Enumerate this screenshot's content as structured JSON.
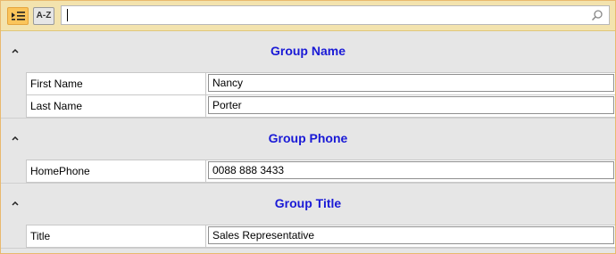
{
  "toolbar": {
    "categorized_icon": "categorized-list-icon",
    "alphabetical_label": "A-Z",
    "search_value": "",
    "search_icon": "magnifier-icon"
  },
  "groups": [
    {
      "title": "Group Name",
      "rows": [
        {
          "label": "First Name",
          "value": "Nancy"
        },
        {
          "label": "Last Name",
          "value": "Porter"
        }
      ]
    },
    {
      "title": "Group Phone",
      "rows": [
        {
          "label": "HomePhone",
          "value": "0088 888 3433"
        }
      ]
    },
    {
      "title": "Group Title",
      "rows": [
        {
          "label": "Title",
          "value": "Sales Representative"
        }
      ]
    }
  ],
  "colors": {
    "group_title": "#1a1ad6",
    "toolbar_bg": "#f3e3ae",
    "active_button": "#fbc55b"
  }
}
